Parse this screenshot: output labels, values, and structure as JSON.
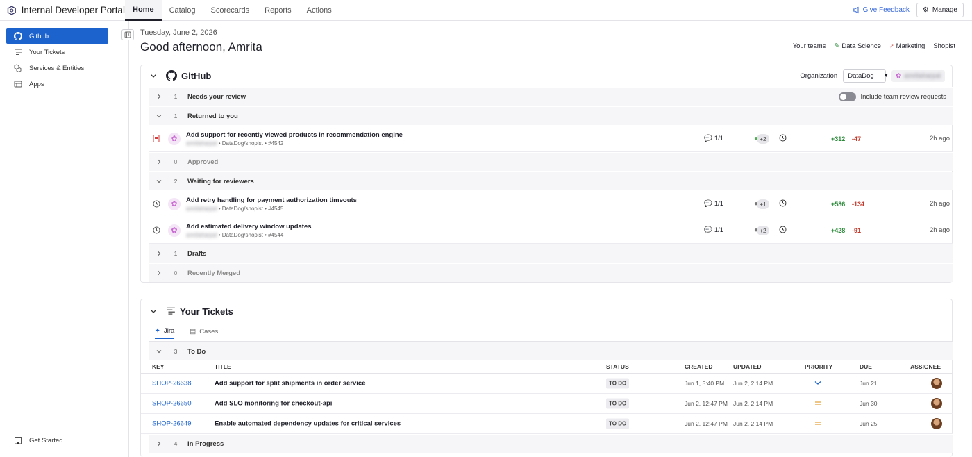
{
  "app": {
    "title": "Internal Developer Portal"
  },
  "nav": {
    "tabs": [
      "Home",
      "Catalog",
      "Scorecards",
      "Reports",
      "Actions"
    ],
    "active": "Home"
  },
  "top_right": {
    "feedback": "Give Feedback",
    "manage": "Manage"
  },
  "sidebar": {
    "items": [
      {
        "label": "Github",
        "icon": "github-icon",
        "active": true
      },
      {
        "label": "Your Tickets",
        "icon": "tickets-icon"
      },
      {
        "label": "Services & Entities",
        "icon": "cubes-icon"
      },
      {
        "label": "Apps",
        "icon": "apps-icon"
      }
    ],
    "footer": "Get Started"
  },
  "header": {
    "date": "Tuesday, June 2, 2026",
    "greeting": "Good afternoon, Amrita"
  },
  "teams": {
    "label": "Your teams",
    "items": [
      "Data Science",
      "Marketing",
      "Shopist"
    ]
  },
  "github": {
    "title": "GitHub",
    "org_label": "Organization",
    "org_value": "DataDog",
    "user": "amritaharpal",
    "toggle_label": "Include team review requests",
    "groups": {
      "needs_review": {
        "count": "1",
        "label": "Needs your review"
      },
      "returned": {
        "count": "1",
        "label": "Returned to you"
      },
      "approved": {
        "count": "0",
        "label": "Approved"
      },
      "waiting": {
        "count": "2",
        "label": "Waiting for reviewers"
      },
      "drafts": {
        "count": "1",
        "label": "Drafts"
      },
      "merged": {
        "count": "0",
        "label": "Recently Merged"
      }
    },
    "prs": [
      {
        "title": "Add support for recently viewed products in recommendation engine",
        "author": "amritaharpal",
        "repo": "• DataDog/shopist • #4542",
        "comments": "1/1",
        "reviewers_more": "+2",
        "additions": "+312",
        "deletions": "-47",
        "time": "2h ago"
      },
      {
        "title": "Add retry handling for payment authorization timeouts",
        "author": "amritaharpal",
        "repo": "• DataDog/shopist • #4545",
        "comments": "1/1",
        "reviewers_more": "+1",
        "additions": "+586",
        "deletions": "-134",
        "time": "2h ago"
      },
      {
        "title": "Add estimated delivery window updates",
        "author": "amritaharpal",
        "repo": "• DataDog/shopist • #4544",
        "comments": "1/1",
        "reviewers_more": "+2",
        "additions": "+428",
        "deletions": "-91",
        "time": "2h ago"
      }
    ]
  },
  "tickets": {
    "title": "Your Tickets",
    "tabs": [
      "Jira",
      "Cases"
    ],
    "todo": {
      "count": "3",
      "label": "To Do"
    },
    "in_progress": {
      "count": "4",
      "label": "In Progress"
    },
    "columns": [
      "KEY",
      "TITLE",
      "STATUS",
      "CREATED",
      "UPDATED",
      "PRIORITY",
      "DUE",
      "ASSIGNEE"
    ],
    "rows": [
      {
        "key": "SHOP-26638",
        "title": "Add support for split shipments in order service",
        "status": "TO DO",
        "created": "Jun 1, 5:40 PM",
        "updated": "Jun 2, 2:14 PM",
        "priority": "low",
        "due": "Jun 21"
      },
      {
        "key": "SHOP-26650",
        "title": "Add SLO monitoring for checkout-api",
        "status": "TO DO",
        "created": "Jun 2, 12:47 PM",
        "updated": "Jun 2, 2:14 PM",
        "priority": "medium",
        "due": "Jun 30"
      },
      {
        "key": "SHOP-26649",
        "title": "Enable automated dependency updates for critical services",
        "status": "TO DO",
        "created": "Jun 2, 12:47 PM",
        "updated": "Jun 2, 2:14 PM",
        "priority": "medium",
        "due": "Jun 25"
      }
    ]
  },
  "colors": {
    "accent": "#1d63ce",
    "additions": "#2e8b3c",
    "deletions": "#c0392b",
    "priority_medium": "#e8a33d"
  }
}
